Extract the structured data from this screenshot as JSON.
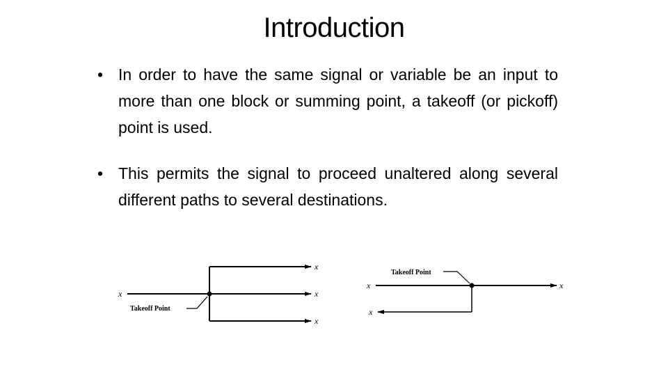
{
  "slide": {
    "title": "Introduction",
    "bullets": [
      {
        "marker": "•",
        "text": "In order to have the same signal or variable be an input to more than one block or summing point, a takeoff (or pickoff) point is used."
      },
      {
        "marker": "•",
        "text": "This permits the signal to proceed unaltered along several different paths to several destinations."
      }
    ]
  },
  "diagrams": {
    "left": {
      "input_label": "x",
      "output_labels": [
        "x",
        "x",
        "x"
      ],
      "takeoff_label": "Takeoff Point"
    },
    "right": {
      "input_label": "x",
      "output_label": "x",
      "branch_label": "x",
      "takeoff_label": "Takeoff Point"
    }
  }
}
